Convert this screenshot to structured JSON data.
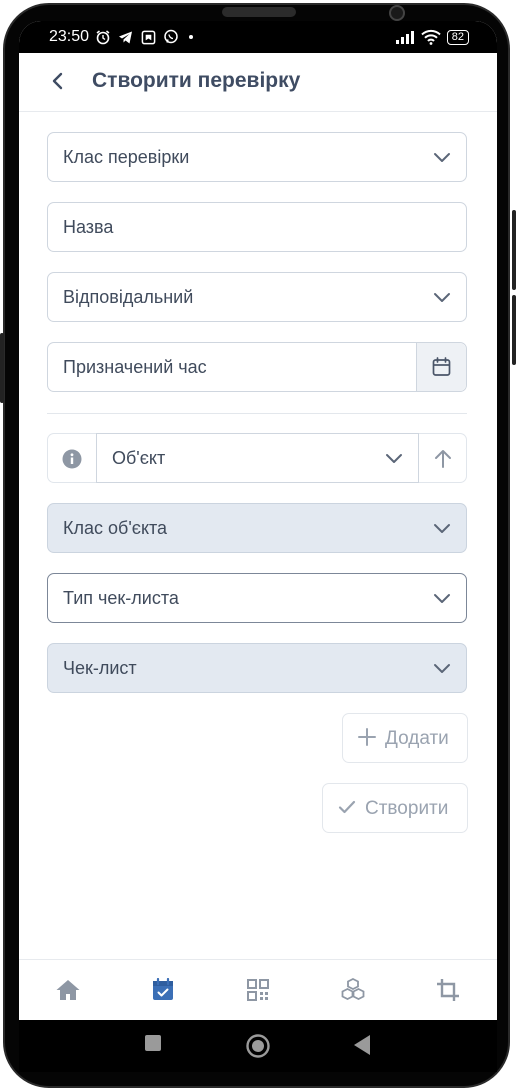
{
  "status_bar": {
    "time": "23:50",
    "battery": "82"
  },
  "header": {
    "title": "Створити перевірку"
  },
  "form": {
    "check_class": "Клас перевірки",
    "name": "Назва",
    "responsible": "Відповідальний",
    "scheduled_time": "Призначений час",
    "object": "Об'єкт",
    "object_class": "Клас об'єкта",
    "checklist_type": "Тип чек-листа",
    "checklist": "Чек-лист"
  },
  "actions": {
    "add": "Додати",
    "create": "Створити"
  },
  "bottom_nav": [
    "home-icon",
    "calendar-check-icon",
    "qr-code-icon",
    "cubes-icon",
    "crop-icon"
  ],
  "colors": {
    "accent": "#3b6fb6",
    "text": "#404b5c",
    "muted": "#9aa3b0",
    "filled_bg": "#e3e9f1"
  }
}
